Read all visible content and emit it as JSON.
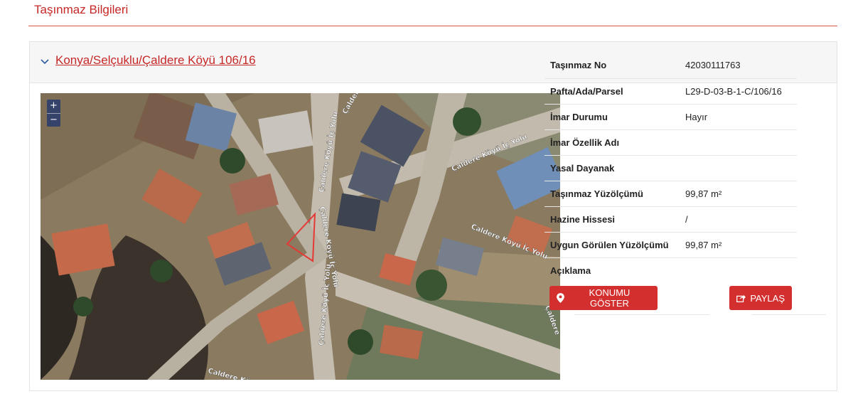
{
  "page_title": "Taşınmaz Bilgileri",
  "panel": {
    "location_link": "Konya/Selçuklu/Çaldere Köyü 106/16"
  },
  "map": {
    "zoom_in": "+",
    "zoom_out": "−",
    "road_labels": [
      "Çaldere Köyü İç Yolu",
      "Çaldere Köyü İç Yolu",
      "Çaldere Köyü İç Yolu",
      "Çaldere Köyü İç Yolu",
      "Çaldere Köyü İç Yolu",
      "Çaldere",
      "Çaldere",
      "Çaldere Köyü İç"
    ]
  },
  "info_rows": [
    {
      "label": "Taşınmaz No",
      "value": "42030111763"
    },
    {
      "label": "Pafta/Ada/Parsel",
      "value": "L29-D-03-B-1-C/106/16"
    },
    {
      "label": "İmar Durumu",
      "value": "Hayır"
    },
    {
      "label": "İmar Özellik Adı",
      "value": ""
    },
    {
      "label": "Yasal Dayanak",
      "value": ""
    },
    {
      "label": "Taşınmaz Yüzölçümü",
      "value": "99,87 m²"
    },
    {
      "label": "Hazine Hissesi",
      "value": "/"
    },
    {
      "label": "Uygun Görülen Yüzölçümü",
      "value": "99,87 m²"
    },
    {
      "label": "Açıklama",
      "value": ""
    }
  ],
  "buttons": {
    "show_location": "KONUMU GÖSTER",
    "share": "PAYLAŞ"
  },
  "colors": {
    "accent": "#c62828",
    "button": "#d32f2f"
  }
}
